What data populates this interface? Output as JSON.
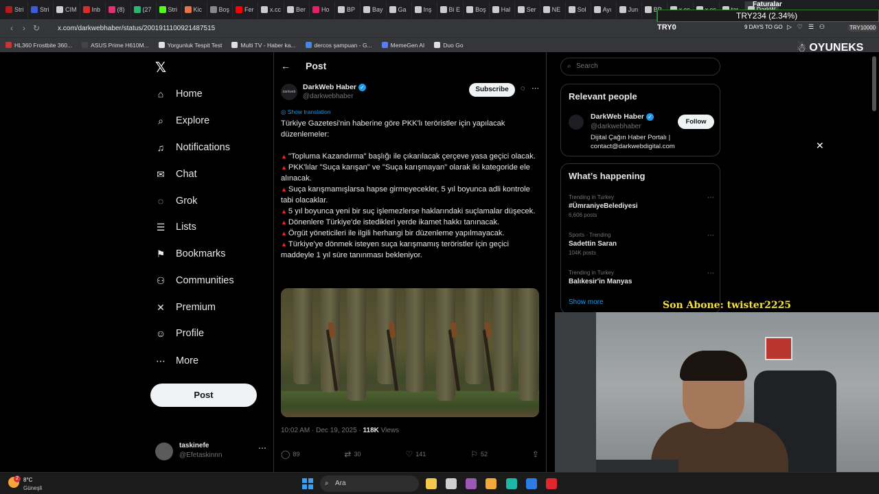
{
  "browser": {
    "tabs": [
      {
        "label": "Stri",
        "color": "#b41a1a"
      },
      {
        "label": "Stri",
        "color": "#3b5bdb"
      },
      {
        "label": "CIM",
        "color": "#cfcfcf"
      },
      {
        "label": "Inb",
        "color": "#d93025"
      },
      {
        "label": "(8)",
        "color": "#e1306c"
      },
      {
        "label": "(27",
        "color": "#2bb673"
      },
      {
        "label": "Stri",
        "color": "#53fc18"
      },
      {
        "label": "Kic",
        "color": "#e8734a"
      },
      {
        "label": "Boş",
        "color": "#888888"
      },
      {
        "label": "Fer",
        "color": "#ff0000"
      },
      {
        "label": "x.cc",
        "color": "#cccccc"
      },
      {
        "label": "Ber",
        "color": "#cccccc"
      },
      {
        "label": "Ho",
        "color": "#e91e63"
      },
      {
        "label": "BP",
        "color": "#cccccc"
      },
      {
        "label": "Bay",
        "color": "#cccccc"
      },
      {
        "label": "Ga",
        "color": "#cccccc"
      },
      {
        "label": "Inş",
        "color": "#cccccc"
      },
      {
        "label": "Bi E",
        "color": "#cccccc"
      },
      {
        "label": "Boş",
        "color": "#cccccc"
      },
      {
        "label": "Hal",
        "color": "#cccccc"
      },
      {
        "label": "Ser",
        "color": "#cccccc"
      },
      {
        "label": "NE",
        "color": "#cccccc"
      },
      {
        "label": "Sol",
        "color": "#cccccc"
      },
      {
        "label": "Ayı",
        "color": "#cccccc"
      },
      {
        "label": "Jun",
        "color": "#cccccc"
      },
      {
        "label": "BP",
        "color": "#cccccc"
      },
      {
        "label": "x.cc",
        "color": "#cccccc"
      },
      {
        "label": "x.cc",
        "color": "#cccccc"
      },
      {
        "label": "tar",
        "color": "#cccccc"
      },
      {
        "label": "DarkW",
        "color": "#cccccc",
        "active": true
      }
    ],
    "url": "x.com/darkwebhaber/status/2001911100921487515",
    "bookmarks": [
      {
        "label": "HL360 Frostbite 360...",
        "color": "#cc3333"
      },
      {
        "label": "ASUS Prime H610M...",
        "color": "#444444"
      },
      {
        "label": "Yorgunluk Tespit Test",
        "color": "#e0e0e0"
      },
      {
        "label": "Multi TV - Haber ka...",
        "color": "#e0e0e0"
      },
      {
        "label": "dercos şampuan - G...",
        "color": "#4285f4"
      },
      {
        "label": "MemeGen AI",
        "color": "#5b7cfa"
      },
      {
        "label": "Duo Go",
        "color": "#e0e0e0"
      }
    ]
  },
  "overlay": {
    "top_label": "Faturalar",
    "ticker_value": "TRY234 (2.34%)",
    "ticker_progress": 0.0234,
    "ticker_symbol": "TRY0",
    "days_text": "9 DAYS TO GO",
    "account_badge": "TRY10000",
    "brand": "OYUNEKS",
    "subscriber_label": "Son Abone: twister2225"
  },
  "sidebar": {
    "items": [
      {
        "label": "Home",
        "icon": "home-icon",
        "glyph": "⌂"
      },
      {
        "label": "Explore",
        "icon": "search-icon",
        "glyph": "⌕"
      },
      {
        "label": "Notifications",
        "icon": "bell-icon",
        "glyph": "♫"
      },
      {
        "label": "Chat",
        "icon": "mail-icon",
        "glyph": "✉"
      },
      {
        "label": "Grok",
        "icon": "grok-icon",
        "glyph": "◌"
      },
      {
        "label": "Lists",
        "icon": "list-icon",
        "glyph": "☰"
      },
      {
        "label": "Bookmarks",
        "icon": "bookmark-icon",
        "glyph": "⚑"
      },
      {
        "label": "Communities",
        "icon": "people-icon",
        "glyph": "⚇"
      },
      {
        "label": "Premium",
        "icon": "x-icon",
        "glyph": "✕"
      },
      {
        "label": "Profile",
        "icon": "person-icon",
        "glyph": "☺"
      },
      {
        "label": "More",
        "icon": "more-circle-icon",
        "glyph": "⋯"
      }
    ],
    "post_label": "Post",
    "account": {
      "name": "taskinefe",
      "handle": "@Efetaskinnn"
    }
  },
  "main": {
    "header_title": "Post",
    "author": {
      "name": "DarkWeb Haber",
      "handle": "@darkwebhaber",
      "avatar_text": "darkweb"
    },
    "subscribe_label": "Subscribe",
    "show_translation": "Show translation",
    "lines": [
      {
        "text": "Türkiye Gazetesi'nin haberine göre PKK'lı teröristler için yapılacak düzenlemeler:",
        "bullet": false
      },
      {
        "text": "",
        "bullet": false
      },
      {
        "text": "\"Topluma Kazandırma\" başlığı ile çıkarılacak çerçeve yasa geçici olacak.",
        "bullet": true
      },
      {
        "text": "PKK'lılar \"Suça karışan\" ve \"Suça karışmayan\"  olarak iki kategoride ele alınacak.",
        "bullet": true
      },
      {
        "text": "Suça karışmamışlarsa hapse girmeyecekler, 5 yıl boyunca adli kontrole tabi olacaklar.",
        "bullet": true
      },
      {
        "text": "5 yıl boyunca yeni bir suç işlemezlerse haklarındaki suçlamalar düşecek.",
        "bullet": true
      },
      {
        "text": "Dönenlere Türkiye'de istedikleri yerde ikamet hakkı tanınacak.",
        "bullet": true
      },
      {
        "text": "Örgüt yöneticileri ile ilgili herhangi bir düzenleme yapılmayacak.",
        "bullet": true
      },
      {
        "text": "Türkiye'ye dönmek isteyen suça karışmamış teröristler için geçici maddeyle 1 yıl süre tanınması bekleniyor.",
        "bullet": true
      }
    ],
    "time": "10:02 AM · Dec 19, 2025 · ",
    "views_count": "118K",
    "views_label": " Views",
    "actions": {
      "replies": "89",
      "reposts": "30",
      "likes": "141",
      "bookmarks": "52"
    }
  },
  "right": {
    "search_placeholder": "Search",
    "relevant_title": "Relevant people",
    "person": {
      "name": "DarkWeb Haber",
      "handle": "@darkwebhaber",
      "bio": "Dijital Çağın Haber Portalı | contact@darkwebdigital.com",
      "follow_label": "Follow"
    },
    "trends_title": "What’s happening",
    "trends": [
      {
        "context": "Trending in Turkey",
        "name": "#ÜmraniyeBelediyesi",
        "posts": "6,606 posts"
      },
      {
        "context": "Sports · Trending",
        "name": "Sadettin Saran",
        "posts": "104K posts"
      },
      {
        "context": "Trending in Turkey",
        "name": "Balıkesir'in Manyas",
        "posts": ""
      }
    ],
    "show_more": "Show more"
  },
  "taskbar": {
    "weather_temp": "8°C",
    "weather_location": "Güneşli",
    "weather_badge": "2",
    "search_placeholder": "Ara",
    "apps": [
      {
        "name": "file-explorer-icon",
        "color": "#f2c94c"
      },
      {
        "name": "terminal-icon",
        "color": "#cfcfcf"
      },
      {
        "name": "copilot-icon",
        "color": "#9b59b6"
      },
      {
        "name": "folder-icon",
        "color": "#f2a93b"
      },
      {
        "name": "edge-icon",
        "color": "#1fb6a6"
      },
      {
        "name": "store-icon",
        "color": "#2d7be5"
      },
      {
        "name": "opera-icon",
        "color": "#e0262e"
      },
      {
        "name": "discord-icon",
        "color": "#5865f2"
      }
    ]
  }
}
